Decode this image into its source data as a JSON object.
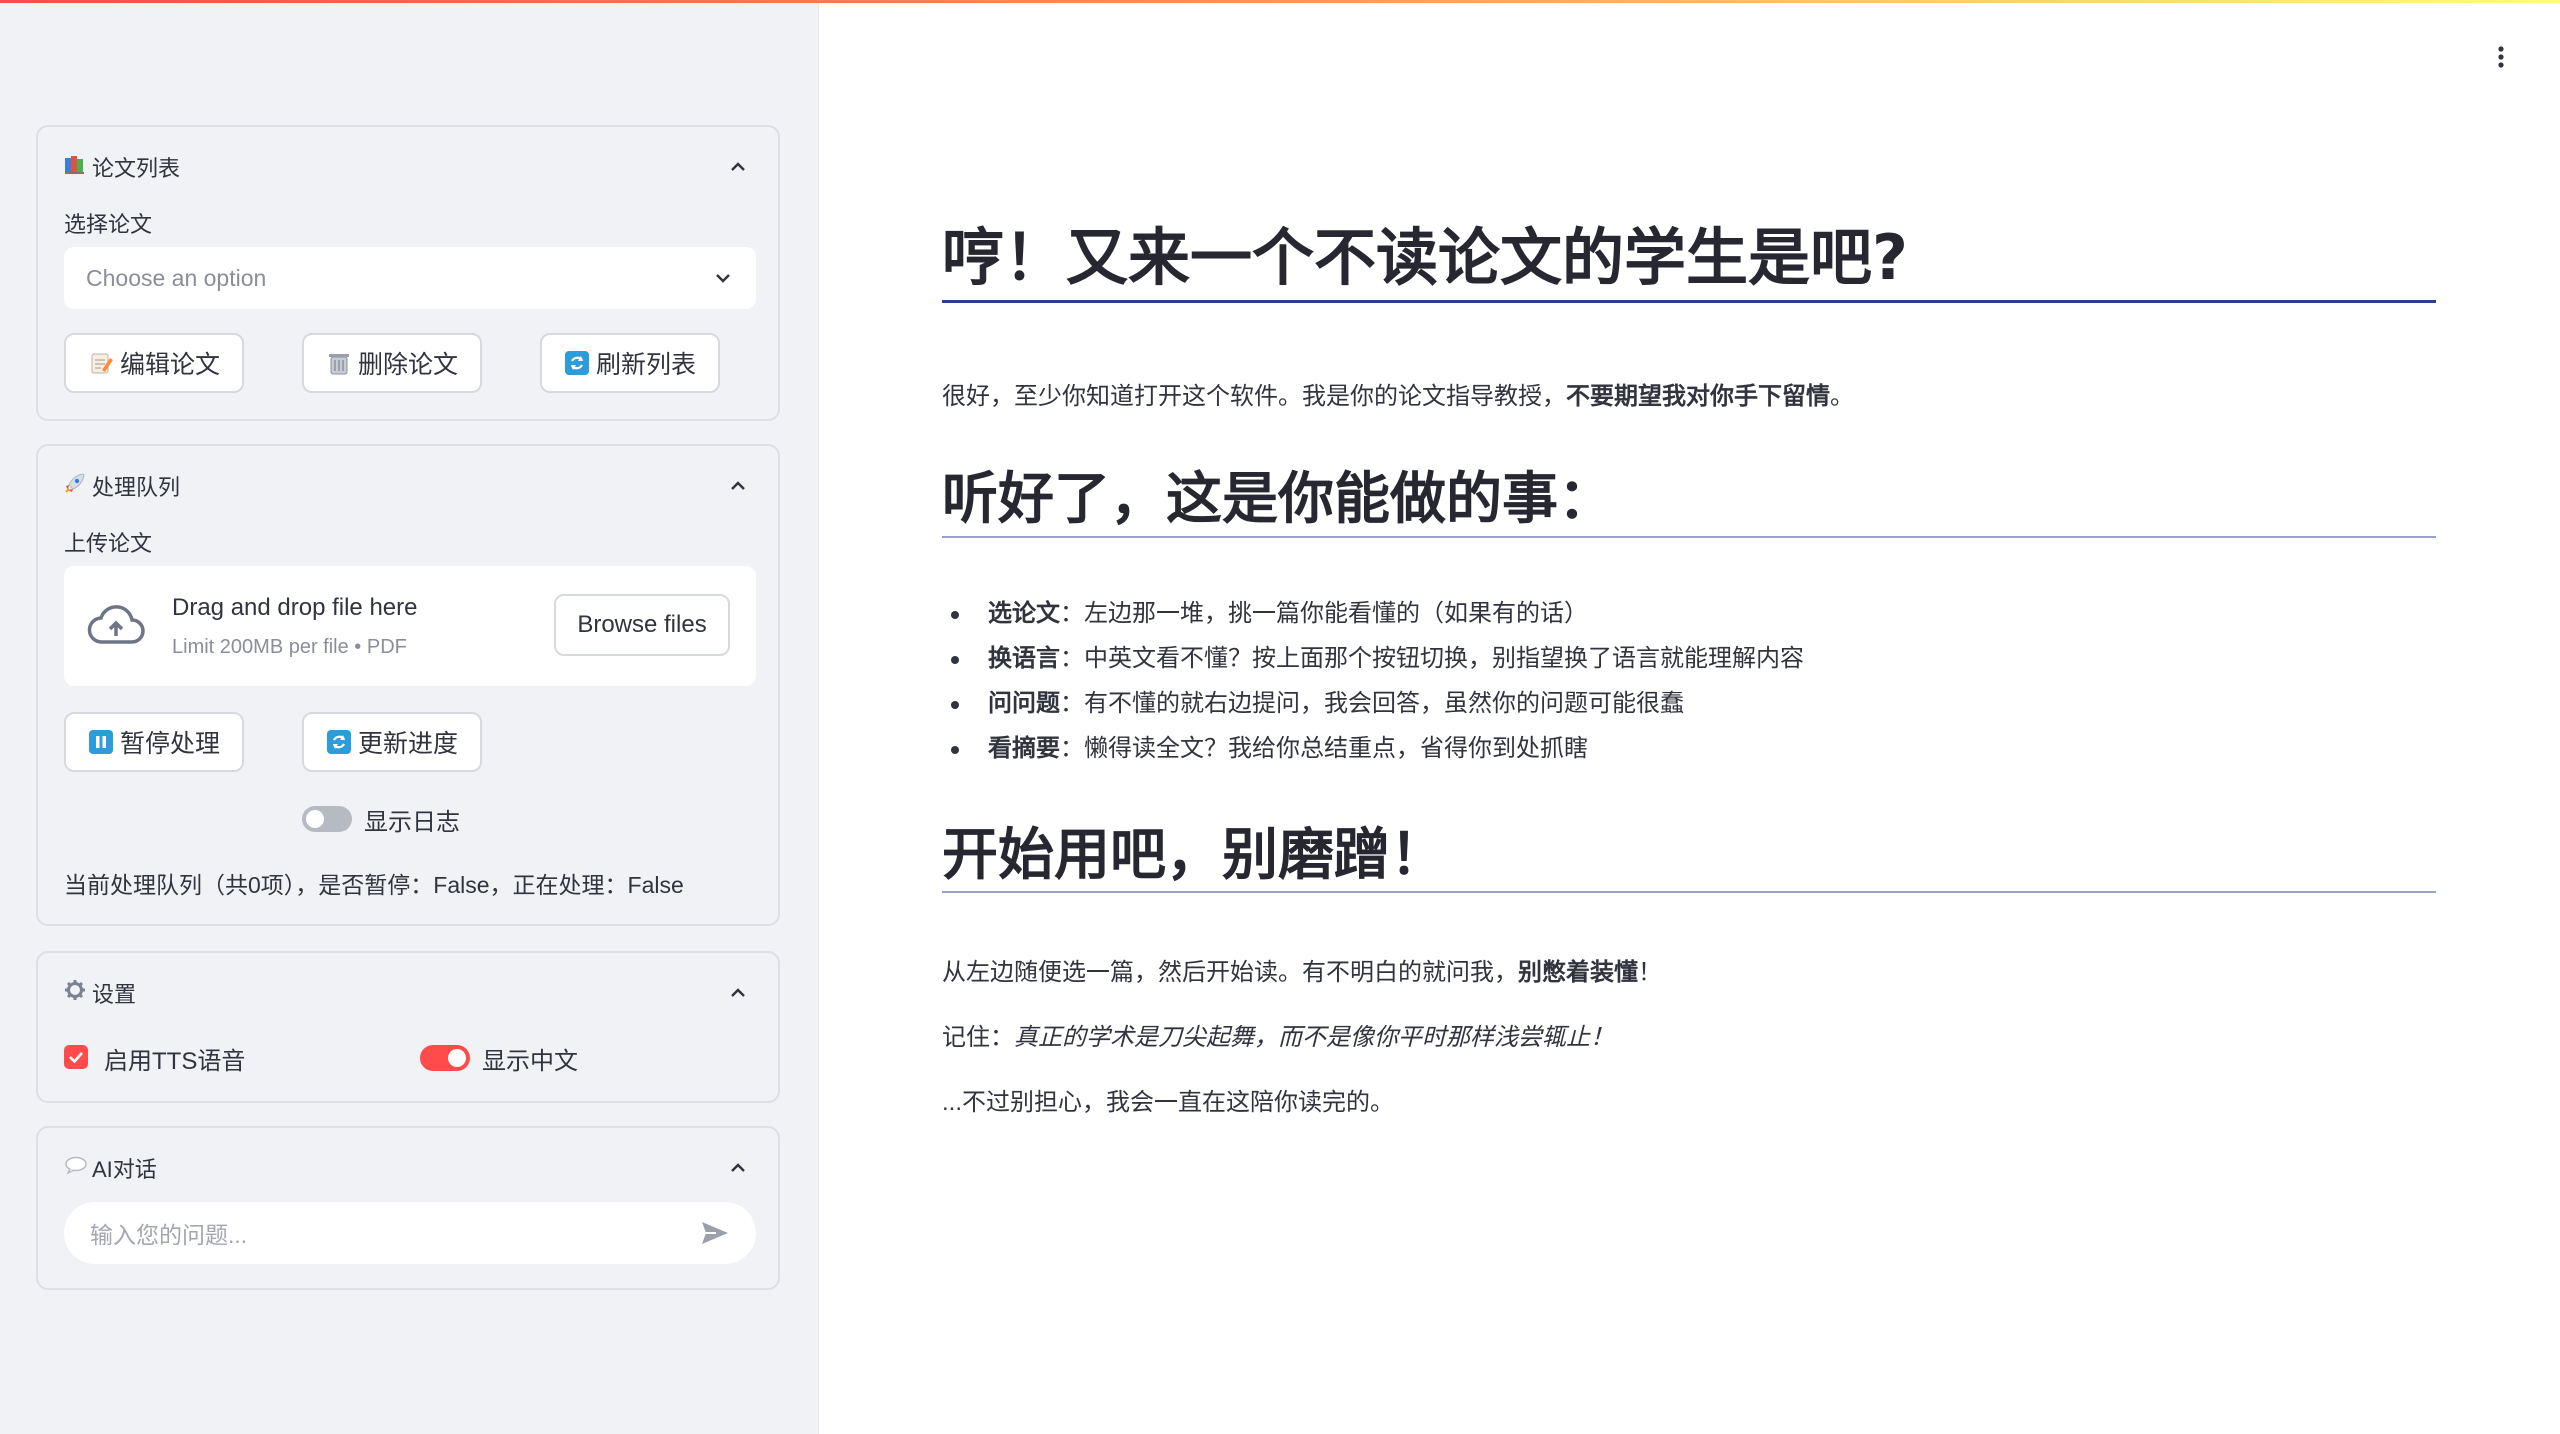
{
  "sidebar": {
    "paper_list": {
      "icon": "books-icon",
      "title": "论文列表",
      "select_label": "选择论文",
      "select_placeholder": "Choose an option",
      "buttons": {
        "edit": "编辑论文",
        "delete": "删除论文",
        "refresh": "刷新列表"
      }
    },
    "queue": {
      "icon": "rocket-icon",
      "title": "处理队列",
      "upload_label": "上传论文",
      "upload_title": "Drag and drop file here",
      "upload_limit": "Limit 200MB per file • PDF",
      "browse_button": "Browse files",
      "buttons": {
        "pause": "暂停处理",
        "update": "更新进度"
      },
      "show_log_label": "显示日志",
      "show_log_on": false,
      "status": "当前处理队列（共0项），是否暂停：False，正在处理：False"
    },
    "settings": {
      "icon": "gear-icon",
      "title": "设置",
      "tts_label": "启用TTS语音",
      "tts_checked": true,
      "chinese_label": "显示中文",
      "chinese_on": true
    },
    "ai_chat": {
      "icon": "speech-bubble-icon",
      "title": "AI对话",
      "input_placeholder": "输入您的问题..."
    }
  },
  "main": {
    "h1": "哼！又来一个不读论文的学生是吧?",
    "intro_plain": "很好，至少你知道打开这个软件。我是你的论文指导教授，",
    "intro_bold": "不要期望我对你手下留情",
    "intro_end": "。",
    "h2": "听好了，这是你能做的事：",
    "features": [
      {
        "bold": "选论文",
        "text": "：左边那一堆，挑一篇你能看懂的（如果有的话）"
      },
      {
        "bold": "换语言",
        "text": "：中英文看不懂？按上面那个按钮切换，别指望换了语言就能理解内容"
      },
      {
        "bold": "问问题",
        "text": "：有不懂的就右边提问，我会回答，虽然你的问题可能很蠢"
      },
      {
        "bold": "看摘要",
        "text": "：懒得读全文？我给你总结重点，省得你到处抓瞎"
      }
    ],
    "h3": "开始用吧，别磨蹭！",
    "p1_plain": "从左边随便选一篇，然后开始读。有不明白的就问我，",
    "p1_bold": "别憋着装懂",
    "p1_end": "！",
    "p2_label": "记住：",
    "p2_italic": "真正的学术是刀尖起舞，而不是像你平时那样浅尝辄止！",
    "p3": "...不过别担心，我会一直在这陪你读完的。"
  },
  "colors": {
    "accent": "#ff4b4b",
    "sidebar_bg": "#f0f2f6",
    "heading_rule_1": "#2d3d8f",
    "heading_rule_2": "#9aa3c4"
  }
}
